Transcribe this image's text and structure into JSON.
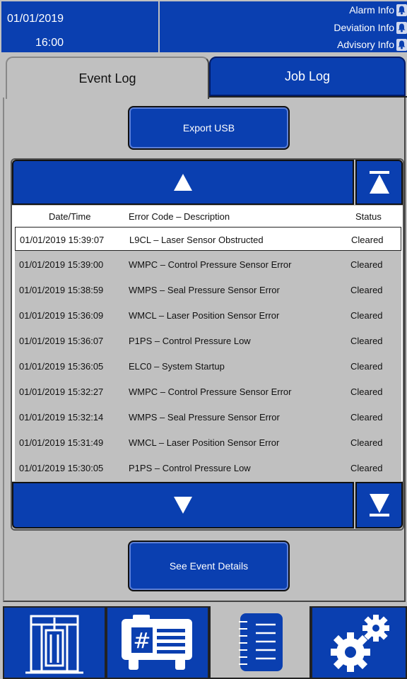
{
  "header": {
    "date": "01/01/2019",
    "time": "16:00",
    "alerts": [
      {
        "label": "Alarm Info",
        "icon": "bell-icon"
      },
      {
        "label": "Deviation Info",
        "icon": "bell-icon"
      },
      {
        "label": "Advisory Info",
        "icon": "bell-icon"
      }
    ]
  },
  "tabs": {
    "event_log": "Event Log",
    "job_log": "Job Log",
    "active": "Event Log"
  },
  "export_button": "Export USB",
  "table": {
    "columns": [
      "Date/Time",
      "Error Code – Description",
      "Status"
    ],
    "rows": [
      {
        "datetime": "01/01/2019 15:39:07",
        "desc": "L9CL – Laser Sensor Obstructed",
        "status": "Cleared",
        "selected": true
      },
      {
        "datetime": "01/01/2019 15:39:00",
        "desc": "WMPC – Control Pressure Sensor Error",
        "status": "Cleared"
      },
      {
        "datetime": "01/01/2019 15:38:59",
        "desc": "WMPS – Seal Pressure Sensor Error",
        "status": "Cleared"
      },
      {
        "datetime": "01/01/2019 15:36:09",
        "desc": "WMCL – Laser Position Sensor Error",
        "status": "Cleared"
      },
      {
        "datetime": "01/01/2019 15:36:07",
        "desc": "P1PS – Control Pressure Low",
        "status": "Cleared"
      },
      {
        "datetime": "01/01/2019 15:36:05",
        "desc": "ELC0 – System Startup",
        "status": "Cleared"
      },
      {
        "datetime": "01/01/2019 15:32:27",
        "desc": "WMPC – Control Pressure Sensor Error",
        "status": "Cleared"
      },
      {
        "datetime": "01/01/2019 15:32:14",
        "desc": "WMPS – Seal Pressure Sensor Error",
        "status": "Cleared"
      },
      {
        "datetime": "01/01/2019 15:31:49",
        "desc": "WMCL – Laser Position Sensor Error",
        "status": "Cleared"
      },
      {
        "datetime": "01/01/2019 15:30:05",
        "desc": "P1PS – Control Pressure Low",
        "status": "Cleared"
      }
    ]
  },
  "scroll": {
    "up_icon": "triangle-up-icon",
    "top_icon": "scroll-to-top-icon",
    "down_icon": "triangle-down-icon",
    "bottom_icon": "scroll-to-bottom-icon"
  },
  "details_button": "See Event Details",
  "nav": [
    {
      "icon": "machine-icon",
      "active": false
    },
    {
      "icon": "job-card-icon",
      "active": false
    },
    {
      "icon": "notebook-icon",
      "active": true
    },
    {
      "icon": "gears-icon",
      "active": false
    }
  ],
  "colors": {
    "accent": "#0a3fb0",
    "background": "#c0c0c0"
  }
}
